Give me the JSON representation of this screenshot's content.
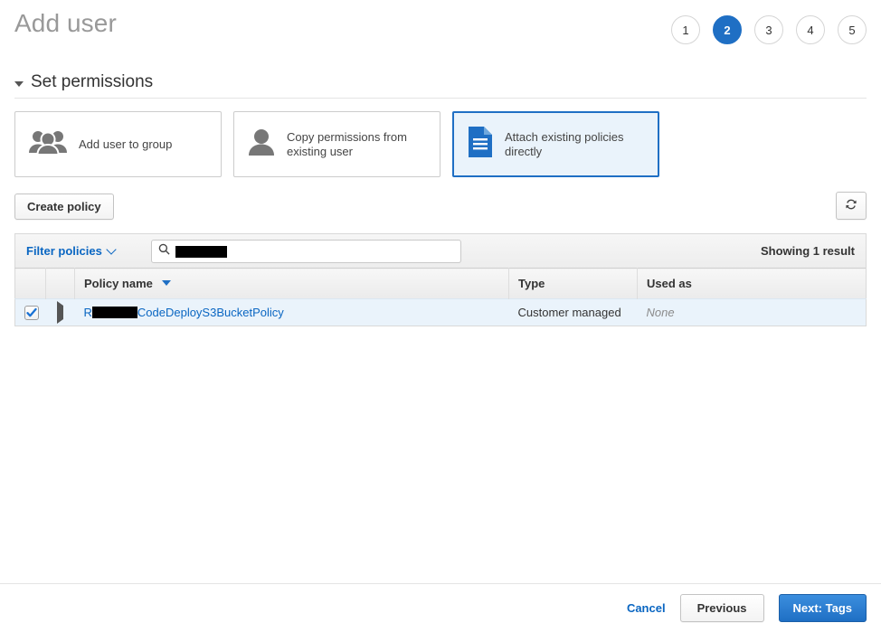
{
  "header": {
    "title": "Add user",
    "steps": [
      {
        "label": "1",
        "active": false
      },
      {
        "label": "2",
        "active": true
      },
      {
        "label": "3",
        "active": false
      },
      {
        "label": "4",
        "active": false
      },
      {
        "label": "5",
        "active": false
      }
    ]
  },
  "section": {
    "title": "Set permissions",
    "expanded": true
  },
  "permission_options": [
    {
      "label": "Add user to group",
      "icon": "users-group-icon",
      "selected": false
    },
    {
      "label": "Copy permissions from existing user",
      "icon": "user-icon",
      "selected": false
    },
    {
      "label": "Attach existing policies directly",
      "icon": "document-icon",
      "selected": true
    }
  ],
  "toolbar": {
    "create_policy_label": "Create policy",
    "refresh_icon": "refresh-icon"
  },
  "filter_bar": {
    "filter_label": "Filter policies",
    "search_value": "",
    "search_value_redacted": true,
    "search_placeholder": "",
    "search_icon": "search-icon",
    "result_count": "Showing 1 result"
  },
  "table": {
    "columns": [
      "",
      "",
      "Policy name",
      "Type",
      "Used as"
    ],
    "sort_column": "Policy name",
    "sort_direction": "descending",
    "rows": [
      {
        "selected": true,
        "expanded": false,
        "name_prefix": "R",
        "name_redacted": true,
        "name_suffix": "CodeDeployS3BucketPolicy",
        "type": "Customer managed",
        "used_as": "None"
      }
    ]
  },
  "footer": {
    "cancel_label": "Cancel",
    "previous_label": "Previous",
    "next_label": "Next: Tags"
  },
  "colors": {
    "accent_blue": "#1f6fc4",
    "link_blue": "#0a66c2",
    "selected_row_bg": "#eaf3fb",
    "title_gray": "#999999",
    "icon_gray": "#777777"
  }
}
